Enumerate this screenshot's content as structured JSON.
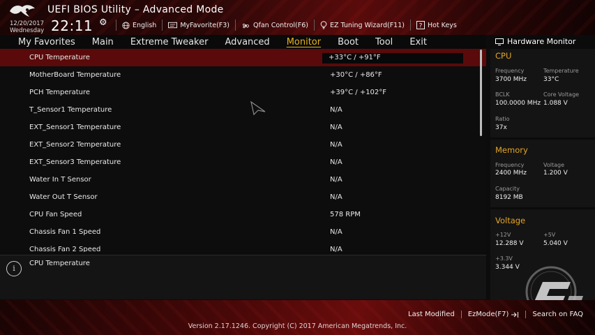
{
  "header": {
    "title": "UEFI BIOS Utility – Advanced Mode",
    "date": "12/20/2017",
    "weekday": "Wednesday",
    "time": "22:11",
    "toolbar": [
      {
        "icon": "globe-icon",
        "label": "English"
      },
      {
        "icon": "favorite-icon",
        "label": "MyFavorite(F3)"
      },
      {
        "icon": "fan-icon",
        "label": "Qfan Control(F6)"
      },
      {
        "icon": "bulb-icon",
        "label": "EZ Tuning Wizard(F11)"
      },
      {
        "icon": "help-icon",
        "label": "Hot Keys"
      }
    ]
  },
  "nav": {
    "items": [
      {
        "label": "My Favorites"
      },
      {
        "label": "Main"
      },
      {
        "label": "Extreme Tweaker"
      },
      {
        "label": "Advanced"
      },
      {
        "label": "Monitor"
      },
      {
        "label": "Boot"
      },
      {
        "label": "Tool"
      },
      {
        "label": "Exit"
      }
    ],
    "active": "Monitor"
  },
  "main": {
    "rows": [
      {
        "label": "CPU Temperature",
        "value": "+33°C / +91°F"
      },
      {
        "label": "MotherBoard Temperature",
        "value": "+30°C / +86°F"
      },
      {
        "label": "PCH Temperature",
        "value": "+39°C / +102°F"
      },
      {
        "label": "T_Sensor1 Temperature",
        "value": "N/A"
      },
      {
        "label": "EXT_Sensor1  Temperature",
        "value": "N/A"
      },
      {
        "label": "EXT_Sensor2  Temperature",
        "value": "N/A"
      },
      {
        "label": "EXT_Sensor3  Temperature",
        "value": "N/A"
      },
      {
        "label": "Water In T Sensor",
        "value": "N/A"
      },
      {
        "label": "Water Out T Sensor",
        "value": "N/A"
      },
      {
        "label": "CPU Fan Speed",
        "value": "578 RPM"
      },
      {
        "label": "Chassis Fan 1 Speed",
        "value": "N/A"
      },
      {
        "label": "Chassis Fan 2 Speed",
        "value": "N/A"
      }
    ]
  },
  "info": {
    "text": "CPU Temperature"
  },
  "hardware_monitor": {
    "title": "Hardware Monitor",
    "cpu": {
      "heading": "CPU",
      "frequency_label": "Frequency",
      "frequency": "3700 MHz",
      "temperature_label": "Temperature",
      "temperature": "33°C",
      "bclk_label": "BCLK",
      "bclk": "100.0000 MHz",
      "core_voltage_label": "Core Voltage",
      "core_voltage": "1.088 V",
      "ratio_label": "Ratio",
      "ratio": "37x"
    },
    "memory": {
      "heading": "Memory",
      "frequency_label": "Frequency",
      "frequency": "2400 MHz",
      "voltage_label": "Voltage",
      "voltage": "1.200 V",
      "capacity_label": "Capacity",
      "capacity": "8192 MB"
    },
    "voltage": {
      "heading": "Voltage",
      "v12_label": "+12V",
      "v12": "12.288 V",
      "v5_label": "+5V",
      "v5": "5.040 V",
      "v33_label": "+3.3V",
      "v33": "3.344 V"
    }
  },
  "footer": {
    "last_modified": "Last Modified",
    "ezmode": "EzMode(F7)",
    "search": "Search on FAQ",
    "copyright": "Version 2.17.1246. Copyright (C) 2017 American Megatrends, Inc."
  },
  "colors": {
    "accent_active": "#e4b321",
    "section_heading": "#e4a626",
    "selected_row": "#5a0a0a"
  }
}
